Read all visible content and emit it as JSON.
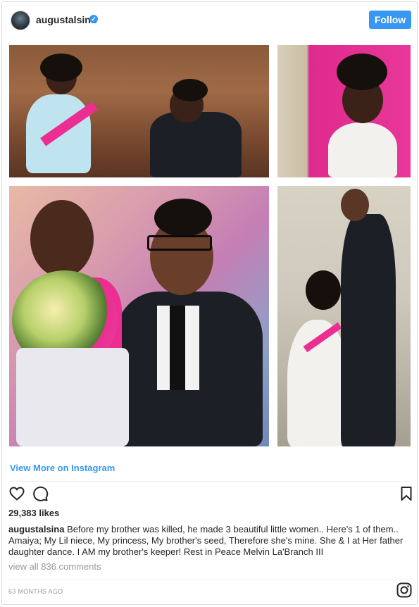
{
  "post": {
    "username": "augustalsina",
    "verified_mark": "✓",
    "follow_label": "Follow",
    "view_more_label": "View More on Instagram",
    "likes": "29,383 likes",
    "caption_user": "augustalsina",
    "caption_text": "Before my brother was killed, he made 3 beautiful little women.. Here's 1 of them.. Amaiya; My Lil niece, My princess, My brother's seed, Therefore she's mine. She & I at Her father daughter dance. I AM my brother's keeper! Rest in Peace Melvin La'Branch III",
    "comments_label": "view all 836 comments",
    "timestamp": "63 MONTHS AGO"
  },
  "icons": {
    "like": "heart-icon",
    "comment": "comment-icon",
    "save": "bookmark-icon",
    "instagram": "instagram-logo-icon",
    "verified": "verified-badge-icon"
  },
  "colors": {
    "accent": "#3897f0",
    "text": "#262626",
    "muted": "#999999",
    "border": "#dbdbdb"
  }
}
